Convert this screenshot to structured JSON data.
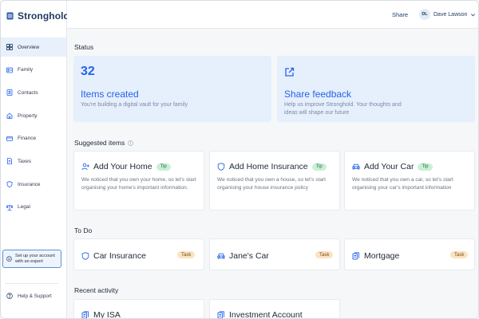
{
  "brand": {
    "name": "Stronghold"
  },
  "sidebar": {
    "items": [
      {
        "label": "Overview",
        "icon": "grid-icon",
        "active": true
      },
      {
        "label": "Family",
        "icon": "family-card-icon"
      },
      {
        "label": "Contacts",
        "icon": "contacts-icon"
      },
      {
        "label": "Property",
        "icon": "house-icon"
      },
      {
        "label": "Finance",
        "icon": "card-icon"
      },
      {
        "label": "Taxes",
        "icon": "document-icon"
      },
      {
        "label": "Insurance",
        "icon": "shield-icon"
      },
      {
        "label": "Legal",
        "icon": "scale-icon"
      }
    ],
    "expert_line1": "Set up your account",
    "expert_line2": "with an expert",
    "help": "Help & Support"
  },
  "header": {
    "share": "Share",
    "user_initials": "DL",
    "user_name": "Dave Lawson"
  },
  "status": {
    "title": "Status",
    "items_count": "32",
    "items_title": "Items created",
    "items_sub": "You're building a digital vault for your family",
    "feedback_title": "Share feedback",
    "feedback_sub_1": "Help us improve Stronghold. Your thoughts and",
    "feedback_sub_2": "ideas will shape our future"
  },
  "suggested": {
    "title": "Suggested items",
    "cards": [
      {
        "title": "Add Your Home",
        "badge": "Tip",
        "desc": "We noticed that you own your home, so let's start organising your home's important information."
      },
      {
        "title": "Add Home Insurance",
        "badge": "Tip",
        "desc": "We noticed that you own a house, so let's start organising your house insurance policy"
      },
      {
        "title": "Add Your Car",
        "badge": "Tip",
        "desc": "We noticed that you own a car, so let's start organising your car's important information"
      }
    ]
  },
  "todo": {
    "title": "To Do",
    "tasks": [
      {
        "title": "Car Insurance",
        "badge": "Task"
      },
      {
        "title": "Jane's Car",
        "badge": "Task"
      },
      {
        "title": "Mortgage",
        "badge": "Task"
      }
    ]
  },
  "recent": {
    "title": "Recent activity",
    "items": [
      {
        "title": "My ISA"
      },
      {
        "title": "Investment Account"
      }
    ]
  },
  "colors": {
    "accent": "#2563eb",
    "brand": "#1e3a5f",
    "tip_bg": "#c9f0d6",
    "task_bg": "#fbe3c2",
    "card_blue": "#e6effc"
  }
}
